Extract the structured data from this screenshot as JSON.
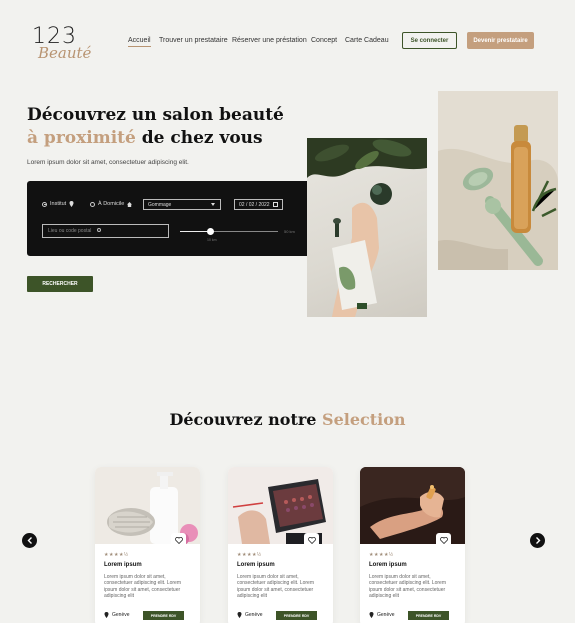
{
  "brand": {
    "logo_number": "123",
    "logo_script": "Beauté"
  },
  "nav": {
    "items": [
      {
        "label": "Accueil"
      },
      {
        "label": "Trouver un prestataire"
      },
      {
        "label": "Réserver une préstation"
      },
      {
        "label": "Concept"
      },
      {
        "label": "Carte Cadeau"
      }
    ],
    "login_label": "Se connecter",
    "become_label": "Devenir prestataire"
  },
  "hero": {
    "title_line1": "Découvrez un salon beauté",
    "title_accent": "à proximité",
    "title_rest": " de chez vous",
    "subtitle": "Lorem ipsum dolor sit amet, consectetuer adipiscing elit."
  },
  "search": {
    "option_institut": "Institut",
    "option_domicile": "À Domicile",
    "selected_option": "institut",
    "service_value": "Gommage",
    "date_value": "02 / 02 / 2022",
    "postal_placeholder": "Lieu ou code postal",
    "distance_min_label": "10 km",
    "distance_max_label": "50 km",
    "button_label": "RECHERCHER"
  },
  "selection": {
    "title_main": "Découvrez notre ",
    "title_accent": "Selection",
    "cards": [
      {
        "rating": "★★★★½",
        "name": "Lorem ipsum",
        "description": "Lorem ipsum dolor sit amet, consectetuer adipiscing elit. Lorem ipsum dolor sit amet, consectetuer adipiscing elit",
        "location": "Genève",
        "book_label": "PRENDRE RDV"
      },
      {
        "rating": "★★★★½",
        "name": "Lorem ipsum",
        "description": "Lorem ipsum dolor sit amet, consectetuer adipiscing elit. Lorem ipsum dolor sit amet, consectetuer adipiscing elit",
        "location": "Genève",
        "book_label": "PRENDRE RDV"
      },
      {
        "rating": "★★★★½",
        "name": "Lorem ipsum",
        "description": "Lorem ipsum dolor sit amet, consectetuer adipiscing elit. Lorem ipsum dolor sit amet, consectetuer adipiscing elit",
        "location": "Genève",
        "book_label": "PRENDRE RDV"
      }
    ]
  },
  "colors": {
    "accent": "#c49f7e",
    "primary_green": "#3d5428",
    "dark_panel": "#111111",
    "background": "#f2f2ef"
  }
}
